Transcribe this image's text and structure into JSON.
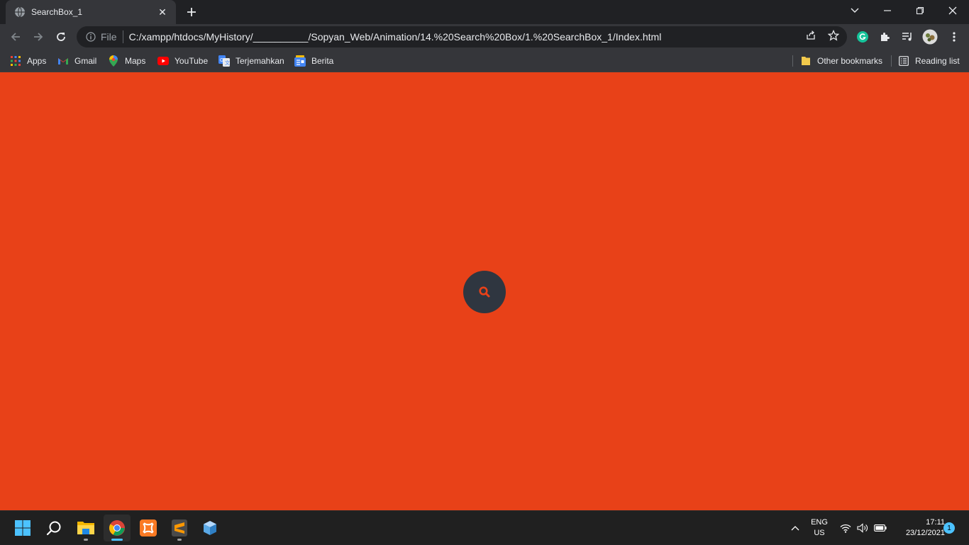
{
  "browser": {
    "tab": {
      "title": "SearchBox_1",
      "favicon": "globe-icon",
      "close": "✕"
    },
    "new_tab": "plus-icon",
    "window_controls": [
      "chevron-down-icon",
      "minimize-icon",
      "restore-icon",
      "close-icon"
    ]
  },
  "toolbar": {
    "scheme_label": "File",
    "url": "C:/xampp/htdocs/MyHistory/__________/Sopyan_Web/Animation/14.%20Search%20Box/1.%20SearchBox_1/Index.html"
  },
  "bookmarks": {
    "left": [
      {
        "label": "Apps",
        "icon": "apps-grid-icon"
      },
      {
        "label": "Gmail",
        "icon": "gmail-icon"
      },
      {
        "label": "Maps",
        "icon": "maps-icon"
      },
      {
        "label": "YouTube",
        "icon": "youtube-icon"
      },
      {
        "label": "Terjemahkan",
        "icon": "translate-icon"
      },
      {
        "label": "Berita",
        "icon": "news-icon"
      }
    ],
    "right": [
      {
        "label": "Other bookmarks",
        "icon": "folder-icon"
      },
      {
        "label": "Reading list",
        "icon": "reading-list-icon"
      }
    ]
  },
  "page": {
    "background": "#e84118",
    "button_color": "#2f3640",
    "icon_color": "#e84118",
    "search_icon": "search-icon"
  },
  "taskbar": {
    "apps": [
      "windows-start-icon",
      "search-icon",
      "file-explorer-icon",
      "chrome-icon",
      "xampp-icon",
      "sublime-text-icon",
      "3d-box-icon"
    ],
    "lang_line1": "ENG",
    "lang_line2": "US",
    "time": "17:11",
    "date": "23/12/2021",
    "notifications": "1"
  }
}
